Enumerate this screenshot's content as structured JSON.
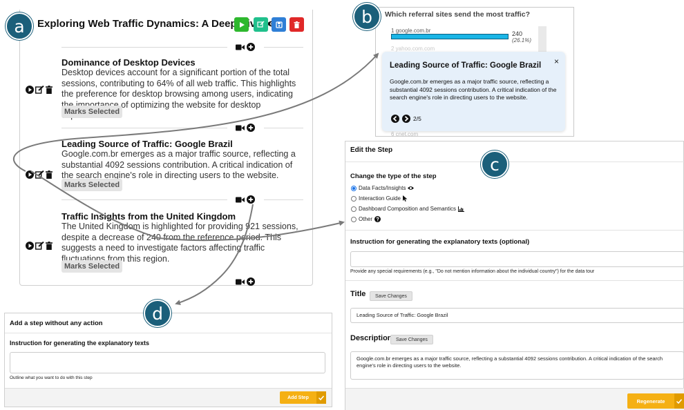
{
  "badges": {
    "a": "a",
    "b": "b",
    "c": "c",
    "d": "d"
  },
  "tour": {
    "title": "Exploring Web Traffic Dynamics: A Deep Dive",
    "steps": [
      {
        "title": "Dominance of Desktop Devices",
        "text": "Desktop devices account for a significant portion of the total sessions, contributing to 64% of all web traffic. This highlights the preference for desktop browsing among users, indicating the importance of optimizing the website for desktop experiences.",
        "marks_label": "Marks Selected"
      },
      {
        "title": "Leading Source of Traffic: Google Brazil",
        "text": "Google.com.br emerges as a major traffic source, reflecting a substantial 4092 sessions contribution. A critical indication of the search engine's role in directing users to the website.",
        "marks_label": "Marks Selected"
      },
      {
        "title": "Traffic Insights from the United Kingdom",
        "text": "The United Kingdom is highlighted for providing 921 sessions, despite a decrease of 240 from the reference period. This suggests a need to investigate factors affecting traffic fluctuations from this region.",
        "marks_label": "Marks Selected"
      }
    ]
  },
  "referral": {
    "question": "Which referral sites send the most traffic?",
    "top_row": {
      "rank": "1",
      "site": "google.com.br",
      "value": "240",
      "pct": "(26.1%)",
      "fraction": 0.261
    },
    "faded_rows": [
      {
        "text": "2  yahoo.com.com"
      },
      {
        "text": "6  cnet.com"
      }
    ],
    "tooltip": {
      "title": "Leading Source of Traffic: Google Brazil",
      "body": "Google.com.br emerges as a major traffic source, reflecting a substantial 4092 sessions contribution. A critical indication of the search engine's role in directing users to the website.",
      "close": "×",
      "page": "2/5"
    }
  },
  "edit": {
    "header": "Edit the Step",
    "type_heading": "Change the type of the step",
    "types": [
      {
        "label": "Data Facts/Insights",
        "icon": "eye-icon",
        "selected": true
      },
      {
        "label": "Interaction Guide",
        "icon": "cursor-icon",
        "selected": false
      },
      {
        "label": "Dashboard Composition and Semantics",
        "icon": "chart-icon",
        "selected": false
      },
      {
        "label": "Other",
        "icon": "question-icon",
        "selected": false
      }
    ],
    "instruction_heading": "Instruction for generating the explanatory texts (optional)",
    "instruction_value": "",
    "instruction_help": "Provide any special requirements (e.g., \"Do not mention information about the individual country\") for the data tour",
    "title_label": "Title",
    "title_save": "Save Changes",
    "title_value": "Leading Source of Traffic: Google Brazil",
    "desc_label": "Description",
    "desc_save": "Save Changes",
    "desc_value": "Google.com.br emerges as a major traffic source, reflecting a substantial 4092 sessions contribution. A critical indication of the search engine's role in directing users to the website.",
    "regenerate": "Regenerate"
  },
  "add_step": {
    "header": "Add a step without any action",
    "instruction_heading": "Instruction for generating the explanatory texts",
    "instruction_value": "",
    "help": "Outline what you want to do with this step",
    "button": "Add Step"
  },
  "colors": {
    "badge": "#1b5f7a",
    "play": "#2eb82e",
    "edit": "#20c08c",
    "save": "#2f7fd6",
    "delete": "#e02828",
    "bar": "#1ab5e6",
    "tooltip_bg": "#e6f0fa",
    "orange": "#f5b014",
    "arrow": "#7a7a7a"
  }
}
